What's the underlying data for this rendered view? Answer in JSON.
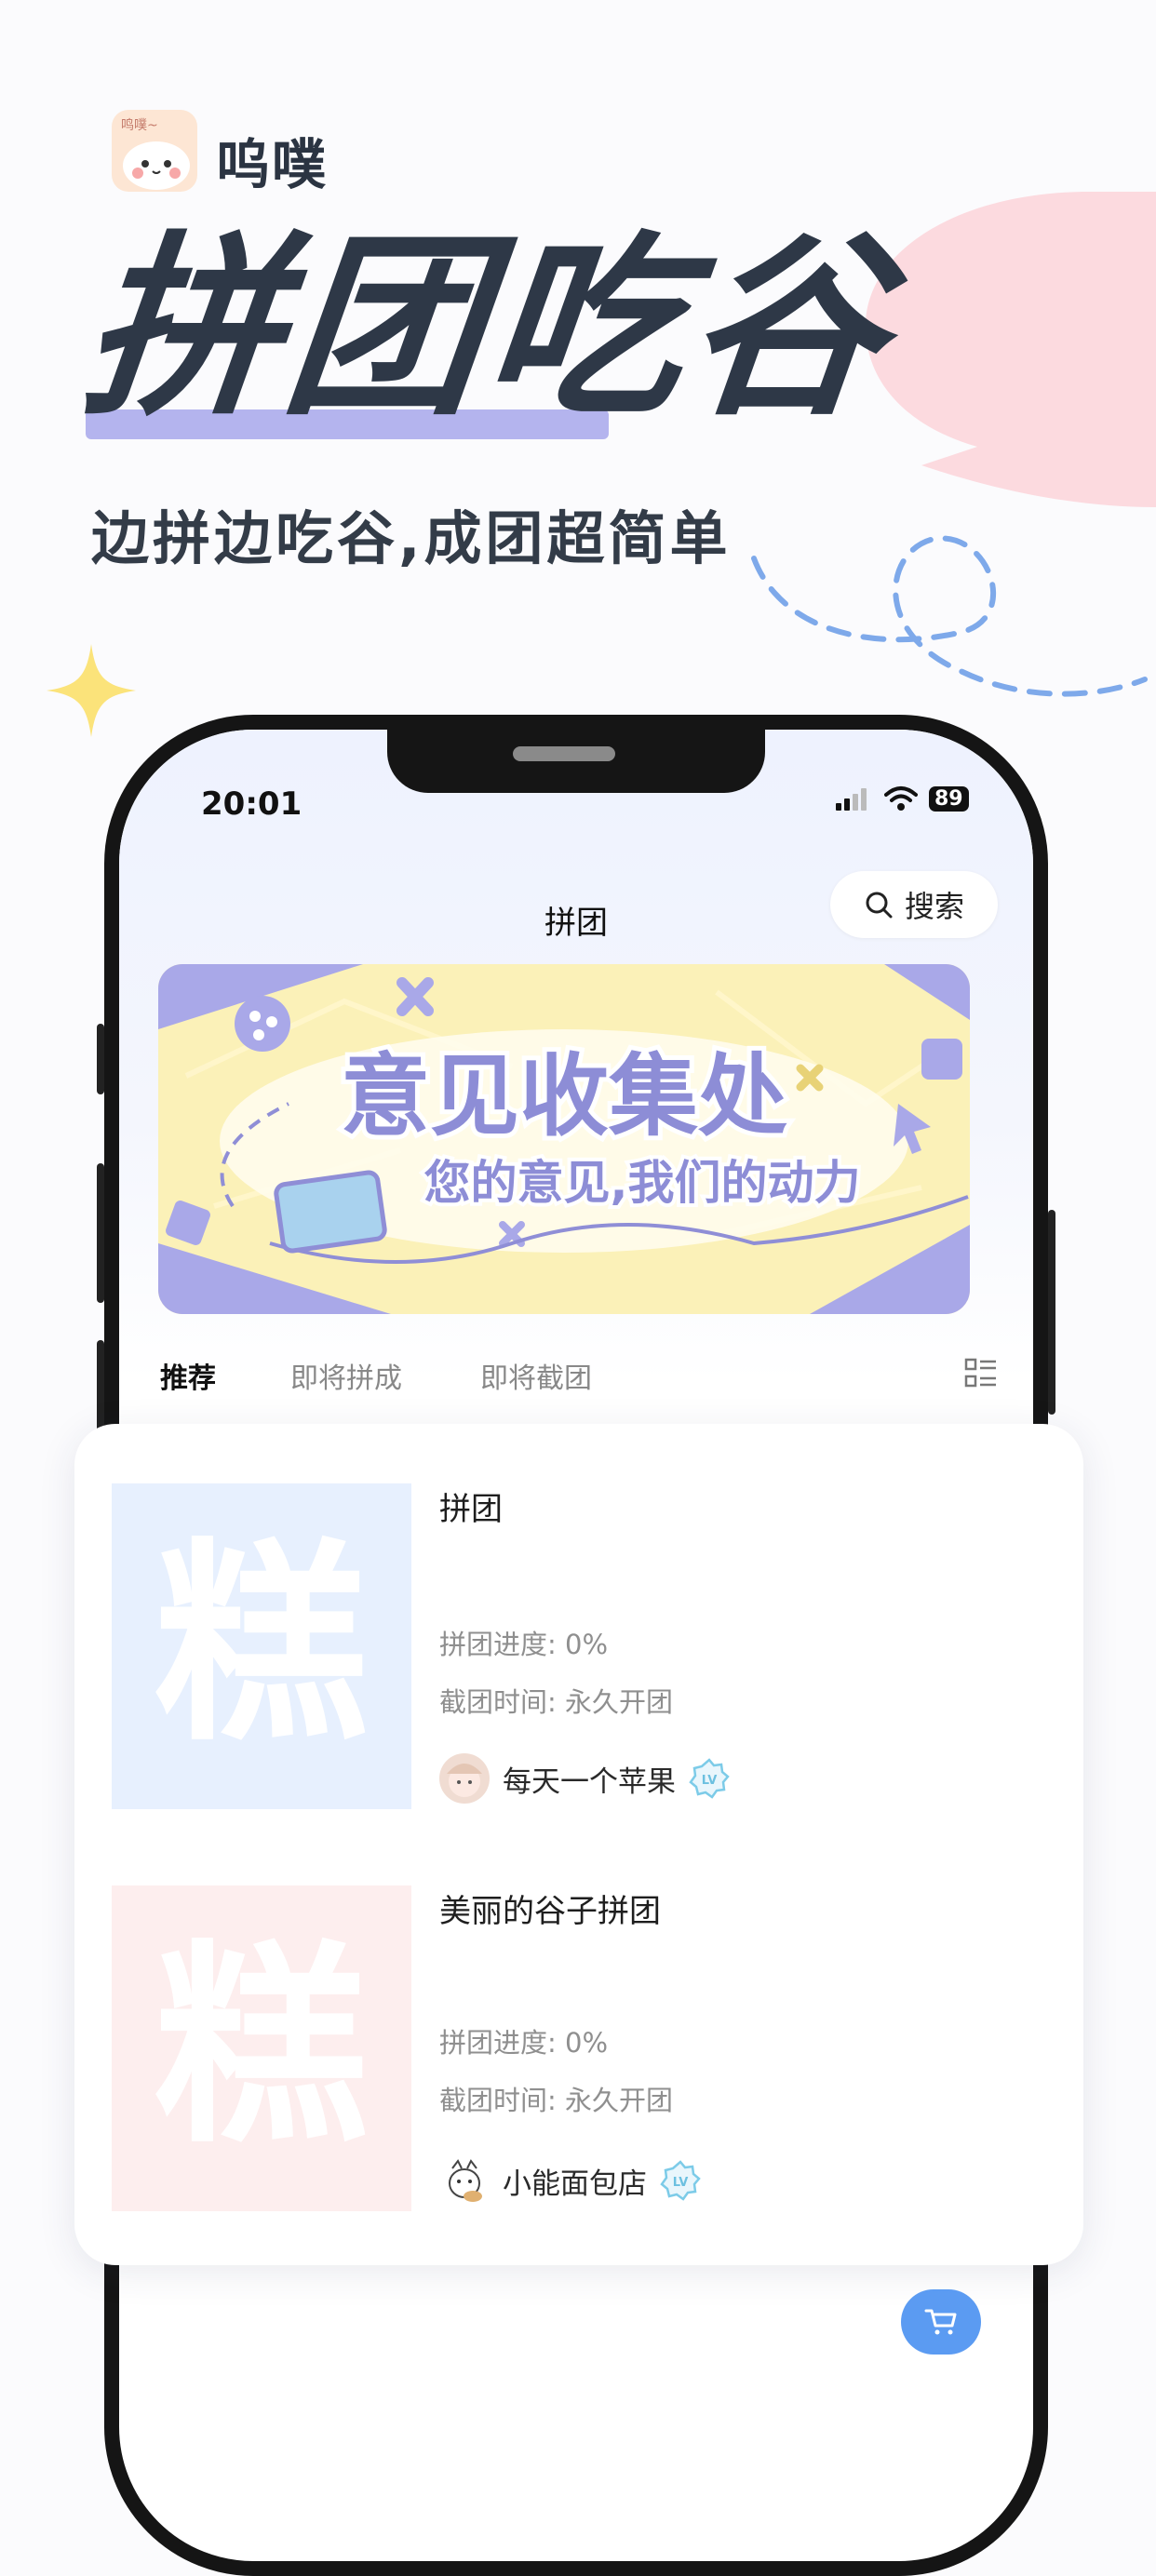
{
  "brand": {
    "name": "呜噗",
    "logo_tag": "鸣噗~"
  },
  "hero": {
    "headline": "拼团吃谷",
    "subtitle": "边拼边吃谷,成团超简单"
  },
  "status_bar": {
    "time": "20:01",
    "battery": "89"
  },
  "nav": {
    "title": "拼团",
    "search_label": "搜索"
  },
  "banner": {
    "title": "意见收集处",
    "subtitle": "您的意见,我们的动力"
  },
  "tabs": [
    {
      "label": "推荐",
      "active": true
    },
    {
      "label": "即将拼成",
      "active": false
    },
    {
      "label": "即将截团",
      "active": false
    }
  ],
  "items": [
    {
      "thumb_char": "糕",
      "thumb_color": "#e7f0fe",
      "title": "拼团",
      "progress": "拼团进度: 0%",
      "deadline": "截团时间: 永久开团",
      "seller": "每天一个苹果",
      "badge": "LV"
    },
    {
      "thumb_char": "糕",
      "thumb_color": "#fdeeee",
      "title": "美丽的谷子拼团",
      "progress": "拼团进度: 0%",
      "deadline": "截团时间: 永久开团",
      "seller": "小能面包店",
      "badge": "LV"
    }
  ],
  "colors": {
    "accent": "#5b9bf2",
    "headline": "#2e3847",
    "bubble": "#fcdadf",
    "underline": "#b4b4ee"
  }
}
